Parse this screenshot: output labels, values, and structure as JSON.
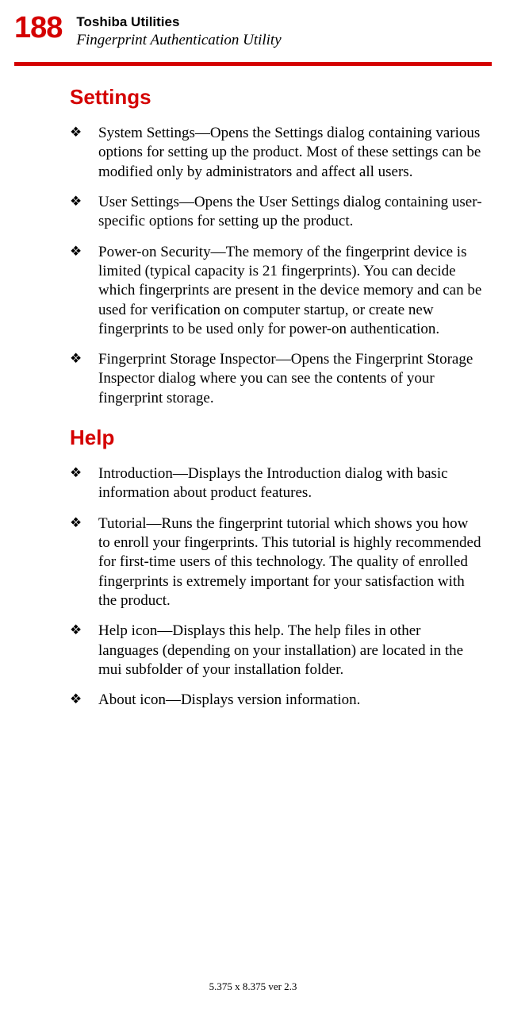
{
  "page_number": "188",
  "header": {
    "title1": "Toshiba Utilities",
    "title2": "Fingerprint Authentication Utility"
  },
  "sections": {
    "settings": {
      "heading": "Settings",
      "items": [
        "System Settings—Opens the Settings dialog containing various options for setting up the product. Most of these settings can be modified only by administrators and affect all users.",
        "User Settings—Opens the User Settings dialog containing user-specific options for setting up the product.",
        "Power-on Security—The memory of the fingerprint device is limited (typical capacity is 21 fingerprints). You can decide which fingerprints are present in the device memory and can be used for verification on computer startup, or create new fingerprints to be used only for power-on authentication.",
        "Fingerprint Storage Inspector—Opens the Fingerprint Storage Inspector dialog where you can see the contents of your fingerprint storage."
      ]
    },
    "help": {
      "heading": "Help",
      "items": [
        "Introduction—Displays the Introduction dialog with basic information about product features.",
        "Tutorial—Runs the fingerprint tutorial which shows you how to enroll your fingerprints. This tutorial is highly recommended for first-time users of this technology. The quality of enrolled fingerprints is extremely important for your satisfaction with the product.",
        "Help icon—Displays this help. The help files in other languages (depending on your installation) are located in the mui subfolder of your installation folder.",
        "About icon—Displays version information."
      ]
    }
  },
  "footer": "5.375 x 8.375 ver 2.3"
}
